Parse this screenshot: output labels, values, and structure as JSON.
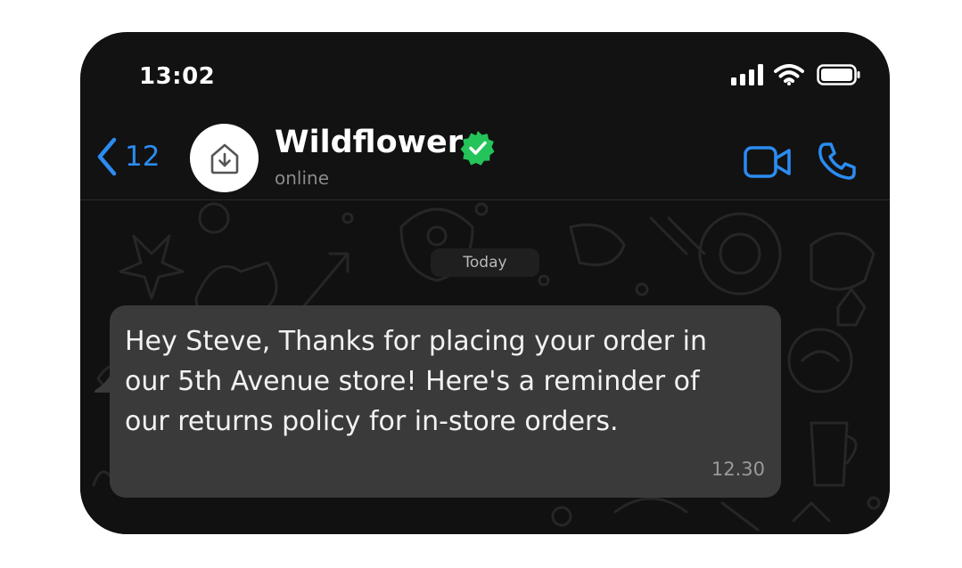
{
  "status_bar": {
    "time": "13:02",
    "icons": [
      "cellular-signal-icon",
      "wifi-icon",
      "battery-icon"
    ]
  },
  "header": {
    "back_count": "12",
    "contact_name": "Wildflower",
    "contact_status": "online",
    "verified": true,
    "icons": [
      "chevron-left-icon",
      "store-logo-icon",
      "verified-badge-icon",
      "video-call-icon",
      "phone-call-icon"
    ]
  },
  "chat": {
    "date_separator": "Today",
    "messages": [
      {
        "text": "Hey Steve, Thanks for placing your order in our 5th Avenue store! Here's a reminder of our returns policy for in-store orders.",
        "time": "12.30"
      }
    ]
  },
  "colors": {
    "background": "#121212",
    "accent": "#2b8cf2",
    "verified": "#25c45a",
    "bubble": "#3a3a3a"
  }
}
